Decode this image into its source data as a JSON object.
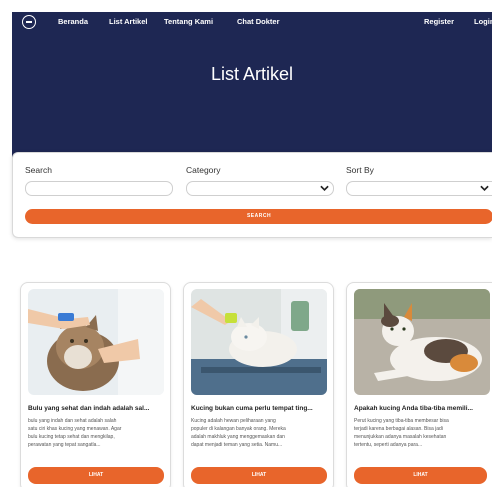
{
  "nav": {
    "links": [
      "Beranda",
      "List Artikel",
      "Tentang Kami",
      "Chat Dokter"
    ],
    "register": "Register",
    "login": "Login"
  },
  "hero": {
    "title": "List Artikel"
  },
  "filters": {
    "search_label": "Search",
    "category_label": "Category",
    "sort_label": "Sort By",
    "search_value": "",
    "category_value": "",
    "sort_value": "",
    "button_label": "SEARCH"
  },
  "articles": [
    {
      "title": "Bulu yang sehat dan indah adalah sal...",
      "desc": [
        "bulu yang indah dan sehat adalah salah",
        "satu ciri khas kucing yang menawan. Agar",
        "bulu kucing tetap sehat dan mengkilap,",
        "perawatan yang tepat sangatla..."
      ],
      "button": "LIHAT"
    },
    {
      "title": "Kucing bukan cuma perlu tempat ting...",
      "desc": [
        "Kucing adalah hewan peliharaan yang",
        "populer di kalangan banyak orang. Mereka",
        "adalah makhluk yang menggemaskan dan",
        "dapat menjadi teman yang setia. Namu..."
      ],
      "button": "LIHAT"
    },
    {
      "title": "Apakah kucing Anda tiba-tiba memili...",
      "desc": [
        "Perut kucing yang tiba-tiba membesar bisa",
        "terjadi karena berbagai alasan. Bisa jadi",
        "menunjukkan adanya masalah kesehatan",
        "tertentu, seperti adanya para..."
      ],
      "button": "LIHAT"
    }
  ],
  "colors": {
    "navy": "#1e2753",
    "accent": "#e8652b"
  }
}
